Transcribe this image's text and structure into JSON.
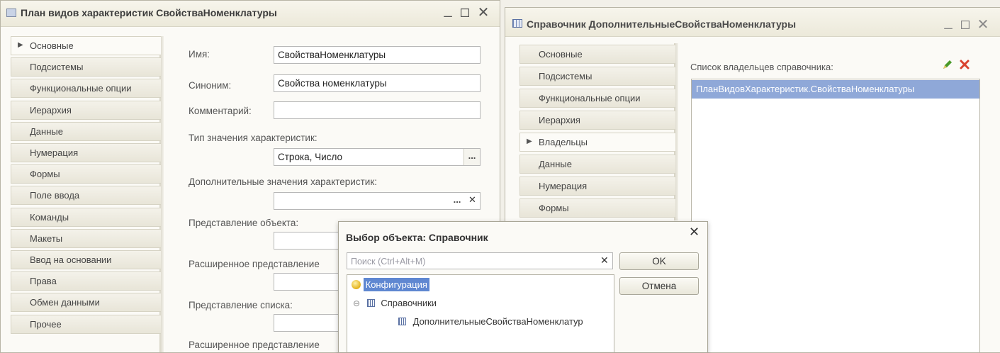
{
  "left_window": {
    "title": "План видов характеристик СвойстваНоменклатуры",
    "controls": {
      "minimize": "_",
      "maximize": "□",
      "close": "✕"
    },
    "tabs": [
      {
        "label": "Основные",
        "active": true
      },
      {
        "label": "Подсистемы"
      },
      {
        "label": "Функциональные опции"
      },
      {
        "label": "Иерархия"
      },
      {
        "label": "Данные"
      },
      {
        "label": "Нумерация"
      },
      {
        "label": "Формы"
      },
      {
        "label": "Поле ввода"
      },
      {
        "label": "Команды"
      },
      {
        "label": "Макеты"
      },
      {
        "label": "Ввод на основании"
      },
      {
        "label": "Права"
      },
      {
        "label": "Обмен данными"
      },
      {
        "label": "Прочее"
      }
    ],
    "form": {
      "name_label": "Имя:",
      "name_value": "СвойстваНоменклатуры",
      "synonym_label": "Синоним:",
      "synonym_value": "Свойства номенклатуры",
      "comment_label": "Комментарий:",
      "comment_value": "",
      "value_type_label": "Тип значения характеристик:",
      "value_type_value": "Строка, Число",
      "select_button": "...",
      "additional_values_label": "Дополнительные значения характеристик:",
      "additional_values_value": "",
      "clear_button": "✕",
      "object_presentation_label": "Представление объекта:",
      "extended_object_presentation_label": "Расширенное представление",
      "list_presentation_label": "Представление списка:",
      "extended_list_presentation_label": "Расширенное представление"
    }
  },
  "right_window": {
    "title": "Справочник ДополнительныеСвойстваНоменклатуры",
    "controls": {
      "minimize": "_",
      "maximize": "□",
      "close": "✕"
    },
    "tabs": [
      {
        "label": "Основные"
      },
      {
        "label": "Подсистемы"
      },
      {
        "label": "Функциональные опции"
      },
      {
        "label": "Иерархия"
      },
      {
        "label": "Владельцы",
        "active": true
      },
      {
        "label": "Данные"
      },
      {
        "label": "Нумерация"
      },
      {
        "label": "Формы"
      }
    ],
    "owners_label": "Список владельцев справочника:",
    "owners": [
      "ПланВидовХарактеристик.СвойстваНоменклатуры"
    ],
    "colors": {
      "edit_icon": "#4a9a2a",
      "delete_icon": "#d9432f",
      "selection": "#8fa8d8"
    }
  },
  "dialog": {
    "title": "Выбор объекта: Справочник",
    "close": "✕",
    "search_placeholder": "Поиск (Ctrl+Alt+M)",
    "search_clear": "✕",
    "ok_label": "OK",
    "cancel_label": "Отмена",
    "tree": {
      "root": "Конфигурация",
      "group": "Справочники",
      "expander": "⊖",
      "item": "ДополнительныеСвойстваНоменклатур"
    }
  }
}
